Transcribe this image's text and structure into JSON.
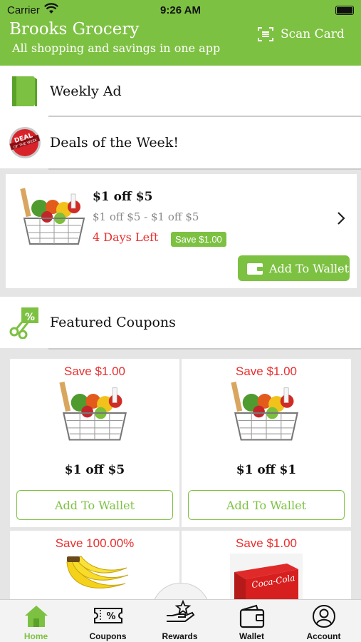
{
  "status_bar": {
    "carrier": "Carrier",
    "time": "9:26 AM"
  },
  "header": {
    "title": "Brooks Grocery",
    "subtitle": "All shopping and savings in one app",
    "scan_label": "Scan Card"
  },
  "sections": {
    "weekly_ad": "Weekly Ad",
    "deals": "Deals of the Week!",
    "featured": "Featured Coupons"
  },
  "deal_badge": {
    "line1": "DEAL",
    "line2": "OF THE WEEK"
  },
  "deal": {
    "title": "$1 off $5",
    "subtitle": "$1 off $5 - $1 off $5",
    "days_left": "4 Days Left",
    "save": "Save $1.00",
    "add_label": "Add To Wallet"
  },
  "coupons": [
    {
      "save": "Save $1.00",
      "title": "$1 off $5",
      "add_label": "Add To Wallet"
    },
    {
      "save": "Save $1.00",
      "title": "$1 off $1",
      "add_label": "Add To Wallet"
    },
    {
      "save": "Save 100.00%"
    },
    {
      "save": "Save $1.00",
      "product_text": "Coca-Cola"
    }
  ],
  "tabs": [
    {
      "label": "Home",
      "icon": "home-icon",
      "active": true
    },
    {
      "label": "Coupons",
      "icon": "coupon-ticket-icon"
    },
    {
      "label": "Rewards",
      "icon": "rewards-hand-star-icon"
    },
    {
      "label": "Wallet",
      "icon": "wallet-icon"
    },
    {
      "label": "Account",
      "icon": "account-person-icon"
    }
  ],
  "colors": {
    "brand_green": "#7dc142",
    "alert_red": "#e8302f"
  }
}
